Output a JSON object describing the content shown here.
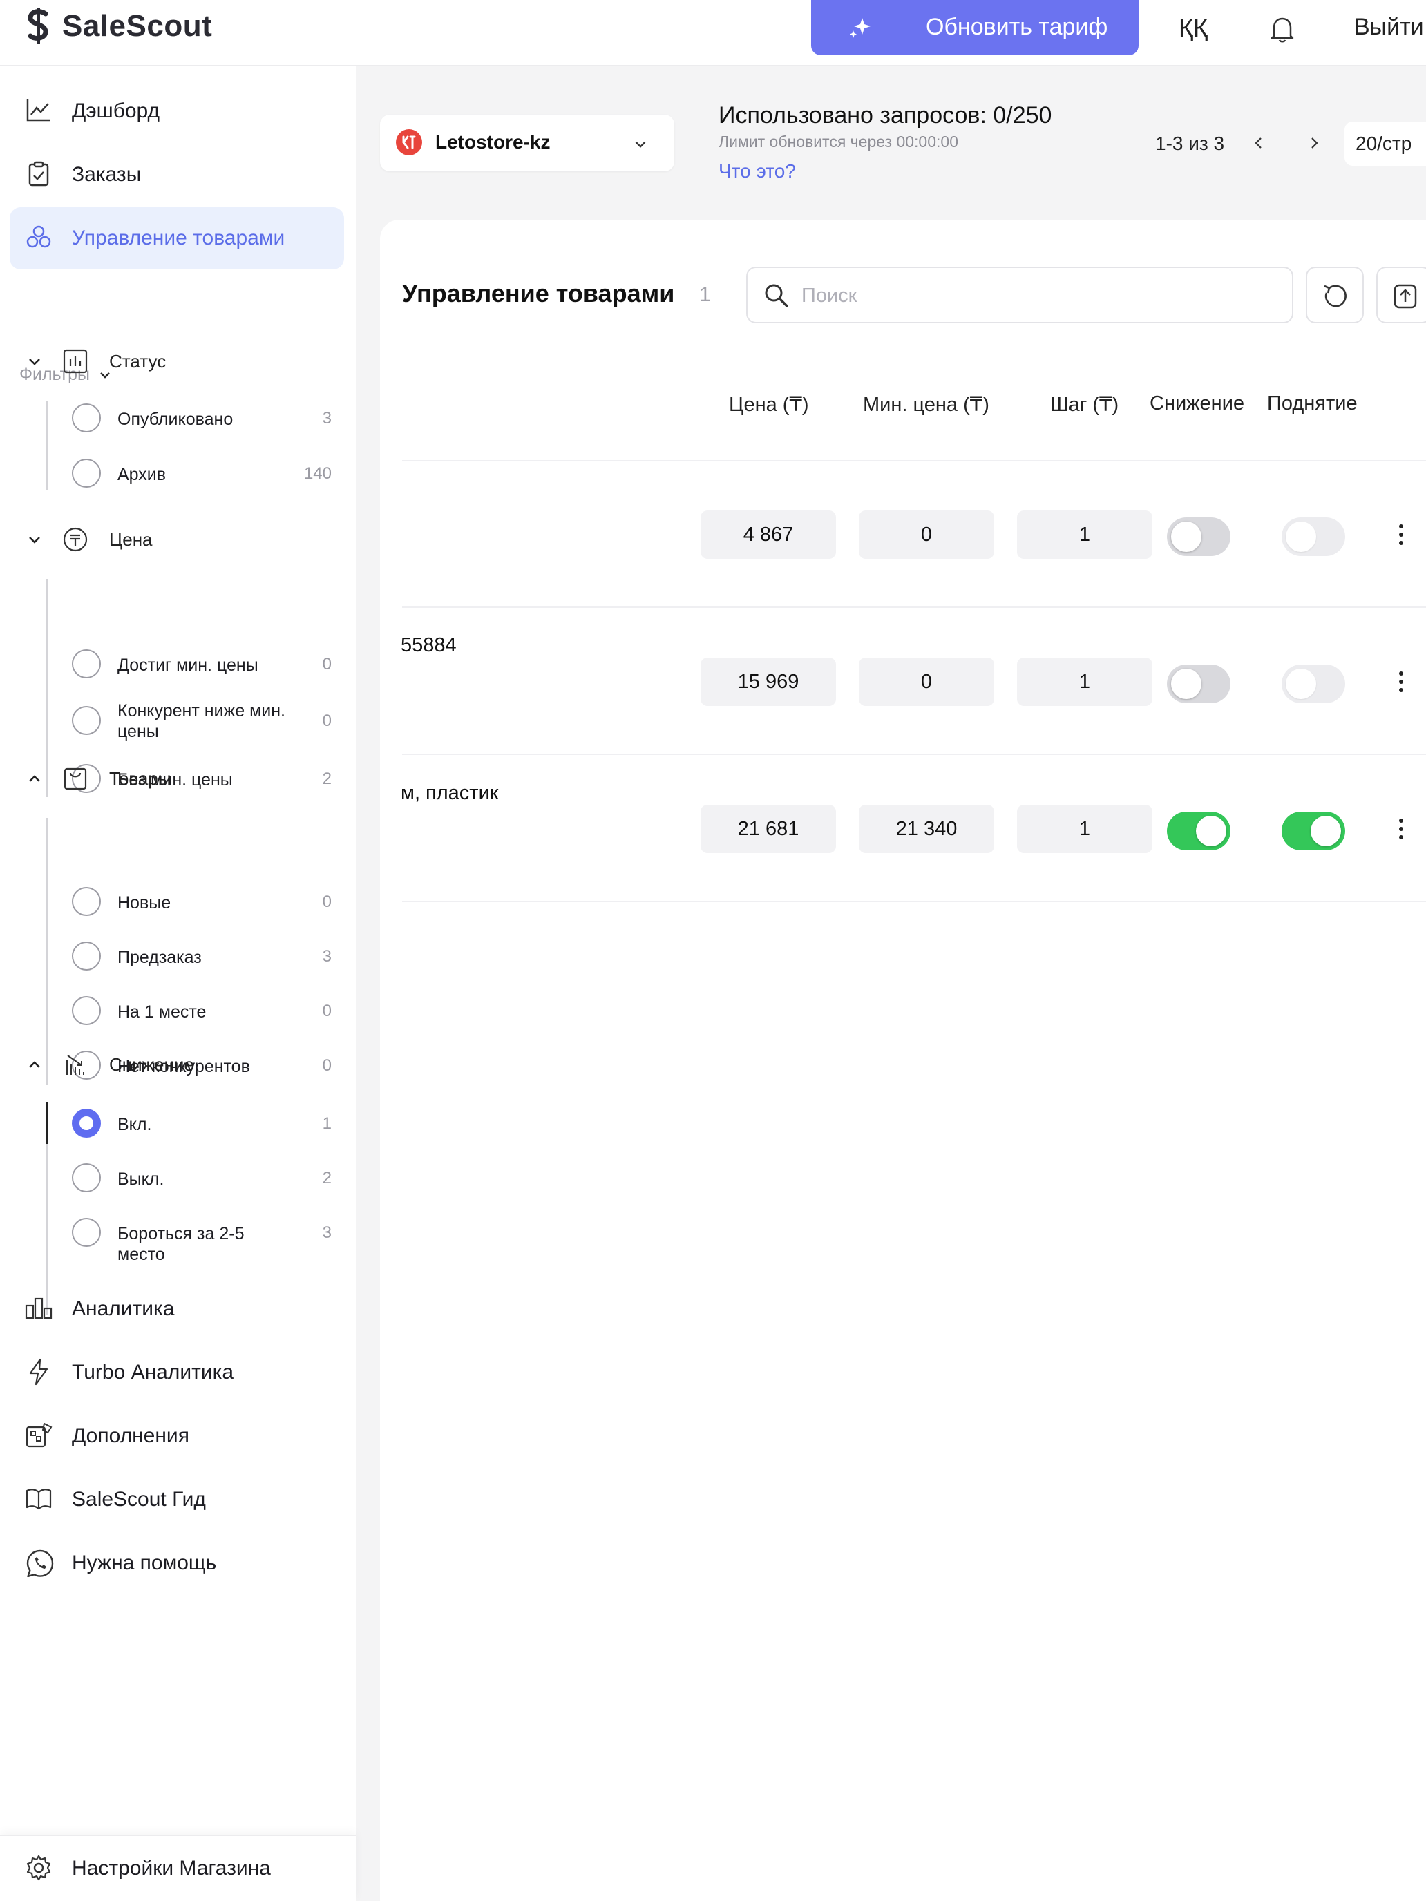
{
  "header": {
    "logo_text": "SaleScout",
    "upgrade_label": "Обновить тариф",
    "language": "ҚҚ",
    "logout_label": "Выйти"
  },
  "sidebar": {
    "items": [
      {
        "label": "Дэшборд",
        "icon": "line-chart-icon"
      },
      {
        "label": "Заказы",
        "icon": "clipboard-icon"
      },
      {
        "label": "Управление товарами",
        "icon": "boxes-icon",
        "active": true
      }
    ],
    "filters_label": "Фильтры",
    "groups": [
      {
        "title": "Статус",
        "options": [
          {
            "label": "Опубликовано",
            "count": "3"
          },
          {
            "label": "Архив",
            "count": "140"
          }
        ]
      },
      {
        "title": "Цена",
        "options": [
          {
            "label": "Достиг мин. цены",
            "count": "0"
          },
          {
            "label": "Конкурент ниже мин. цены",
            "count": "0"
          },
          {
            "label": "Без мин. цены",
            "count": "2"
          }
        ]
      },
      {
        "title": "Товары",
        "options": [
          {
            "label": "Новые",
            "count": "0"
          },
          {
            "label": "Предзаказ",
            "count": "3"
          },
          {
            "label": "На 1 месте",
            "count": "0"
          },
          {
            "label": "Нет конкурентов",
            "count": "0"
          }
        ]
      },
      {
        "title": "Снижение",
        "options": [
          {
            "label": "Вкл.",
            "count": "1",
            "selected": true
          },
          {
            "label": "Выкл.",
            "count": "2"
          },
          {
            "label": "Бороться за 2-5 место",
            "count": "3"
          }
        ]
      }
    ],
    "bottom_items": [
      {
        "label": "Аналитика",
        "icon": "analytics-icon"
      },
      {
        "label": "Turbo Аналитика",
        "icon": "lightning-icon"
      },
      {
        "label": "Дополнения",
        "icon": "addons-icon"
      },
      {
        "label": "SaleScout Гид",
        "icon": "book-icon"
      },
      {
        "label": "Нужна помощь",
        "icon": "whatsapp-icon"
      }
    ],
    "settings_label": "Настройки Магазина"
  },
  "store": {
    "name": "Letostore-kz"
  },
  "usage": {
    "text": "Использовано запросов: 0/250",
    "limit_text": "Лимит обновится через 00:00:00",
    "help_link": "Что это?"
  },
  "pagination": {
    "range": "1-3 из 3",
    "per_page": "20/стр"
  },
  "panel": {
    "title": "Управление товарами",
    "count": "1",
    "search_placeholder": "Поиск"
  },
  "table": {
    "columns": [
      "Цена (₸)",
      "Мин. цена (₸)",
      "Шаг (₸)",
      "Снижение",
      "Поднятие"
    ],
    "rows": [
      {
        "name": "",
        "price": "4 867",
        "min_price": "0",
        "step": "1",
        "decrease": false,
        "increase": false
      },
      {
        "name": "55884",
        "price": "15 969",
        "min_price": "0",
        "step": "1",
        "decrease": false,
        "increase": false
      },
      {
        "name": "м, пластик",
        "price": "21 681",
        "min_price": "21 340",
        "step": "1",
        "decrease": true,
        "increase": true
      }
    ]
  },
  "colors": {
    "accent": "#6b73f0",
    "toggle_on": "#34c759",
    "active_bg": "#eaf0fd"
  }
}
